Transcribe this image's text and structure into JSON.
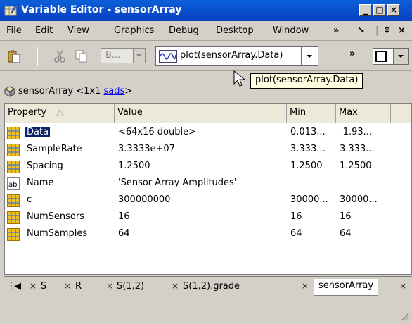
{
  "window": {
    "title": "Variable Editor - sensorArray",
    "minimize_glyph": "_",
    "maximize_glyph": "□",
    "close_glyph": "×",
    "accent": "#0a5fd9"
  },
  "menu": {
    "items": [
      "File",
      "Edit",
      "View",
      "Graphics",
      "Debug",
      "Desktop",
      "Window"
    ],
    "overflow_glyph": "»",
    "undock_glyph": "↘",
    "restore_glyph": "⇞",
    "close_glyph": "×"
  },
  "toolbar": {
    "combo_text": "B...",
    "plot_label": "plot(sensorArray.Data)",
    "overflow_glyph": "»"
  },
  "tooltip": {
    "text": "plot(sensorArray.Data)"
  },
  "breadcrumb": {
    "prefix": "sensorArray <1x1 ",
    "class_link": "sads",
    "suffix": ">"
  },
  "table": {
    "headers": {
      "property": "Property",
      "sort_glyph": "△",
      "value": "Value",
      "min": "Min",
      "max": "Max"
    },
    "rows": [
      {
        "name": "Data",
        "value": "<64x16 double>",
        "min": "0.013...",
        "max": "-1.93...",
        "icon": "matrix-icon",
        "selected": true
      },
      {
        "name": "SampleRate",
        "value": "3.3333e+07",
        "min": "3.333...",
        "max": "3.333...",
        "icon": "matrix-icon"
      },
      {
        "name": "Spacing",
        "value": "1.2500",
        "min": "1.2500",
        "max": "1.2500",
        "icon": "matrix-icon"
      },
      {
        "name": "Name",
        "value": "'Sensor Array Amplitudes'",
        "min": "",
        "max": "",
        "icon": "text-icon",
        "icon_text": "ab"
      },
      {
        "name": "c",
        "value": "300000000",
        "min": "30000...",
        "max": "30000...",
        "icon": "matrix-icon"
      },
      {
        "name": "NumSensors",
        "value": "16",
        "min": "16",
        "max": "16",
        "icon": "matrix-icon"
      },
      {
        "name": "NumSamples",
        "value": "64",
        "min": "64",
        "max": "64",
        "icon": "matrix-icon"
      }
    ]
  },
  "tabs": {
    "items": [
      "S",
      "R",
      "S(1,2)",
      "S(1,2).grade"
    ],
    "active": "sensorArray",
    "close_glyph": "×",
    "scroll_left_glyph": "◀"
  },
  "colors": {
    "matrix_icon": "#f0c020",
    "matrix_grid": "#5a7fb8",
    "selection": "#0a246a"
  }
}
